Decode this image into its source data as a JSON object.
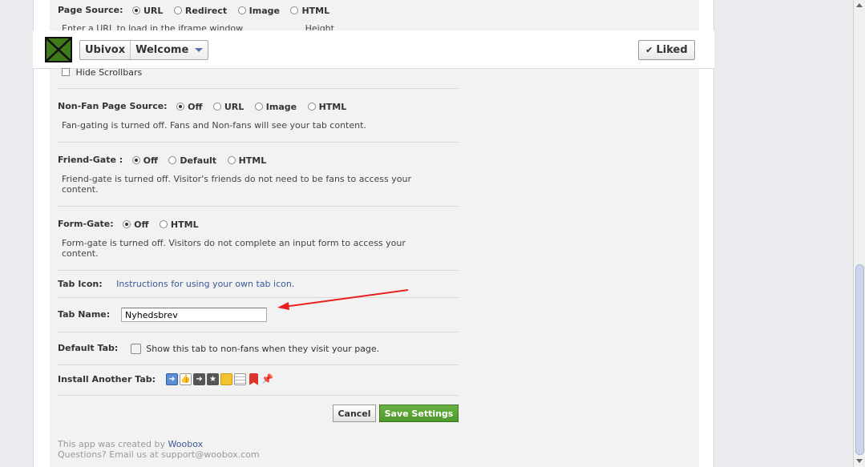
{
  "header": {
    "page_name": "Ubivox",
    "tab_name": "Welcome",
    "liked_label": "Liked",
    "liked_icon": "checkmark-icon"
  },
  "page_source": {
    "label": "Page Source:",
    "options": [
      "URL",
      "Redirect",
      "Image",
      "HTML"
    ],
    "selected": "URL",
    "help_partial": "Enter a URL to load in the iframe window",
    "height_label": "Height"
  },
  "hide_scrollbars_label": "Hide Scrollbars",
  "non_fan": {
    "label": "Non-Fan Page Source:",
    "options": [
      "Off",
      "URL",
      "Image",
      "HTML"
    ],
    "selected": "Off",
    "help": "Fan-gating is turned off. Fans and Non-fans will see your tab content."
  },
  "friend_gate": {
    "label": "Friend-Gate :",
    "options": [
      "Off",
      "Default",
      "HTML"
    ],
    "selected": "Off",
    "help": "Friend-gate is turned off. Visitor's friends do not need to be fans to access your content."
  },
  "form_gate": {
    "label": "Form-Gate:",
    "options": [
      "Off",
      "HTML"
    ],
    "selected": "Off",
    "help": "Form-gate is turned off. Visitors do not complete an input form to access your content."
  },
  "tab_icon": {
    "label": "Tab Icon:",
    "link": "Instructions for using your own tab icon."
  },
  "tab_name": {
    "label": "Tab Name:",
    "value": "Nyhedsbrev"
  },
  "default_tab": {
    "label": "Default Tab:",
    "text": "Show this tab to non-fans when they visit your page."
  },
  "install_another": {
    "label": "Install Another Tab:",
    "icons": [
      "arrow-box-icon",
      "thumbs-up-icon",
      "arrow-right-icon",
      "star-icon",
      "note-icon",
      "document-icon",
      "bookmark-icon",
      "pin-icon"
    ],
    "icon_colors": [
      "#5a8fd6",
      "#ffffff",
      "#555555",
      "#555555",
      "#f2c230",
      "#ffffff",
      "#d9352a",
      "#4a78c2"
    ]
  },
  "buttons": {
    "cancel": "Cancel",
    "save": "Save Settings"
  },
  "footer": {
    "created_by": "This app was created by",
    "creator_link": "Woobox",
    "questions": "Questions? Email us at support@woobox.com"
  },
  "colors": {
    "save_green": "#4e9a2c",
    "link_blue": "#3b5998",
    "annotation_red": "#e82020"
  }
}
